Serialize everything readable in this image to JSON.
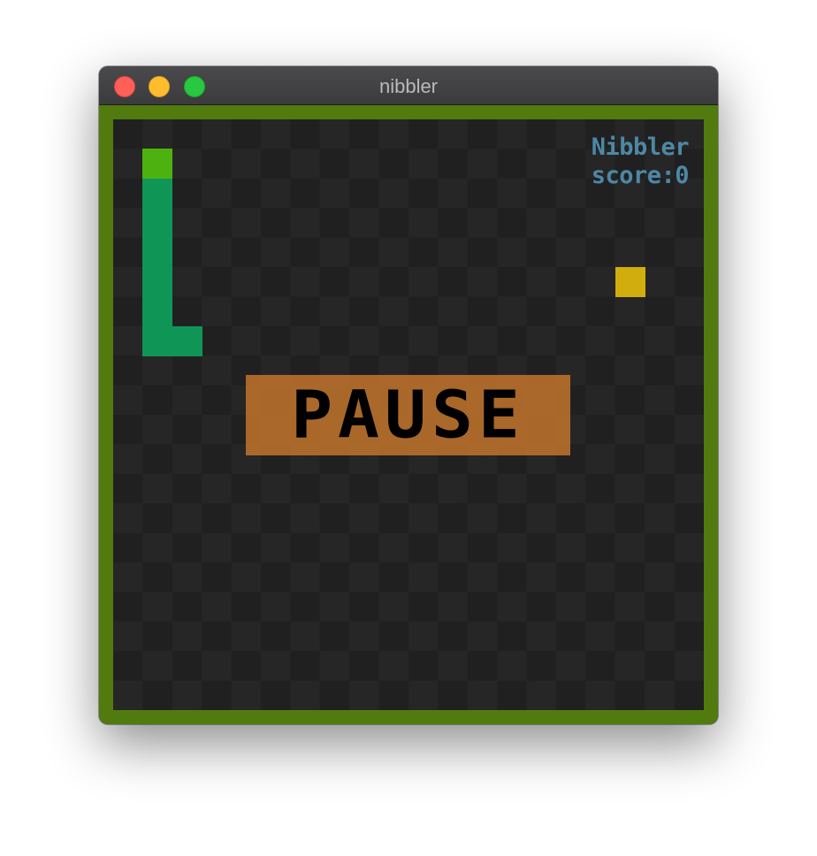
{
  "window": {
    "title": "nibbler",
    "controls": [
      "close",
      "minimize",
      "zoom"
    ]
  },
  "game": {
    "grid_cols": 20,
    "grid_rows": 20,
    "status_label": "PAUSE",
    "hud": {
      "name": "Nibbler",
      "score_text": "score:0",
      "score": 0
    },
    "snake": {
      "head": [
        1,
        1
      ],
      "body": [
        [
          1,
          2
        ],
        [
          1,
          3
        ],
        [
          1,
          4
        ],
        [
          1,
          5
        ],
        [
          1,
          6
        ],
        [
          1,
          7
        ],
        [
          2,
          7
        ]
      ]
    },
    "food": [
      17,
      5
    ],
    "colors": {
      "border": "#517b0e",
      "snake_head": "#4db110",
      "snake_body": "#0f9656",
      "food": "#d1ad0d",
      "hud_text": "#4d88a6",
      "pause_bg": "#c2742c"
    }
  }
}
